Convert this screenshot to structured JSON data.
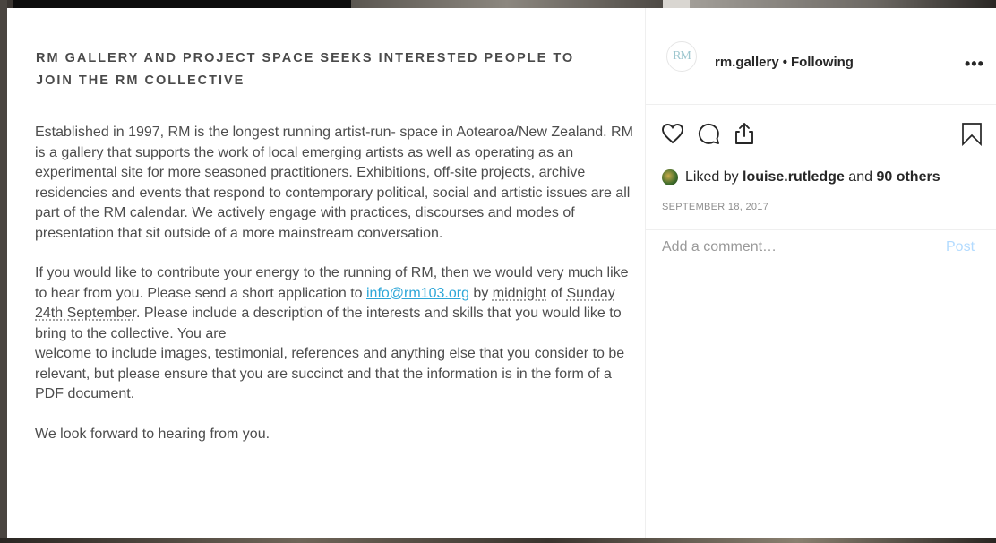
{
  "post": {
    "heading_line1": "RM GALLERY AND PROJECT SPACE SEEKS INTERESTED PEOPLE TO",
    "heading_line2": "JOIN THE RM COLLECTIVE",
    "para1_a": "Established in 1997, RM is the longest running artist-run- space in Aotearoa/New Zealand. RM is a gallery that supports the work of local emerging artists as well as operating as an experimental site for more seasoned practitioners. Exhibitions, off-site projects, archive residencies and events that respond to contemporary political, social and artistic issues are all",
    "para1_b": "part of the RM calendar. We actively engage with practices, discourses and modes of presentation that sit outside of a more mainstream conversation.",
    "para2_a": "If you would like to contribute your energy to the running of RM, then we would very much like to hear from you. Please send a short application to ",
    "para2_email": "info@rm103.org",
    "para2_b": " by ",
    "para2_midnight": "midnight",
    "para2_c": " of ",
    "para2_date": "Sunday 24th September",
    "para2_d": ". Please include a description of the interests and skills that you would like to bring to the collective. You are",
    "para2_e": "welcome to include images, testimonial, references and anything else that you consider to be relevant, but please ensure that you are succinct and that the information is in the form of a PDF document.",
    "para3": "We look forward to hearing from you."
  },
  "side": {
    "avatar_text": "RM",
    "username": "rm.gallery",
    "separator": "•",
    "following": "Following",
    "more": "•••",
    "likes_prefix": "Liked by ",
    "likes_user": "louise.rutledge",
    "likes_mid": " and ",
    "likes_count": "90 others",
    "date": "SEPTEMBER 18, 2017",
    "comment_placeholder": "Add a comment…",
    "post_label": "Post"
  },
  "icons": {
    "like": "heart-icon",
    "comment": "comment-icon",
    "share": "share-icon",
    "save": "bookmark-icon",
    "more": "more-icon"
  }
}
